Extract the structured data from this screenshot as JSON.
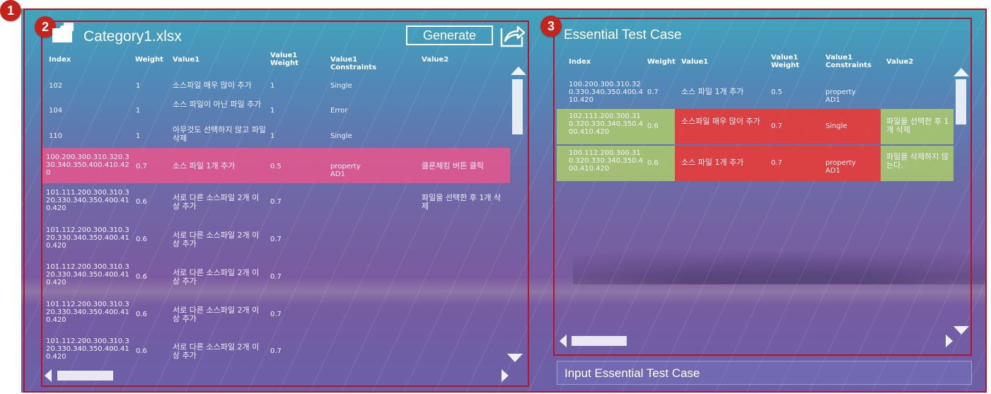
{
  "badges": [
    "1",
    "2",
    "3"
  ],
  "left_panel": {
    "file_name": "Category1.xlsx",
    "generate_label": "Generate",
    "columns": [
      "Index",
      "Weight",
      "Value1",
      "Value1 Weight",
      "Value1 Constraints",
      "Value2"
    ],
    "rows": [
      {
        "index": "102",
        "weight": "1",
        "value1": "소스파일 매우 많이 추가",
        "value1_weight": "1",
        "constraints": "Single",
        "value2": "",
        "highlight": false
      },
      {
        "index": "104",
        "weight": "1",
        "value1": "소스 파일이 아닌 파일 추가",
        "value1_weight": "1",
        "constraints": "Error",
        "value2": "",
        "highlight": false
      },
      {
        "index": "110",
        "weight": "1",
        "value1": "아무것도 선택하지 않고 파일 삭제",
        "value1_weight": "1",
        "constraints": "Single",
        "value2": "",
        "highlight": false
      },
      {
        "index": "100.200.300.310.320.330.340.350.400.410.420",
        "weight": "0.7",
        "value1": "소스 파일 1개 추가",
        "value1_weight": "0.5",
        "constraints": "property AD1",
        "value2": "클론체킹 버튼 클릭",
        "highlight": true
      },
      {
        "index": "101.111.200.300.310.320.330.340.350.400.410.420",
        "weight": "0.6",
        "value1": "서로 다른 소스파일 2개 이상 추가",
        "value1_weight": "0.7",
        "constraints": "",
        "value2": "파일을 선택한 후 1개 삭제",
        "highlight": false
      },
      {
        "index": "101.112.200.300.310.320.330.340.350.400.410.420",
        "weight": "0.6",
        "value1": "서로 다른 소스파일 2개 이상 추가",
        "value1_weight": "0.7",
        "constraints": "",
        "value2": "",
        "highlight": false
      },
      {
        "index": "101.112.200.300.310.320.330.340.350.400.410.420",
        "weight": "0.6",
        "value1": "서로 다른 소스파일 2개 이상 추가",
        "value1_weight": "0.7",
        "constraints": "",
        "value2": "",
        "highlight": false
      },
      {
        "index": "101.112.200.300.310.320.330.340.350.400.410.420",
        "weight": "0.6",
        "value1": "서로 다른 소스파일 2개 이상 추가",
        "value1_weight": "0.7",
        "constraints": "",
        "value2": "",
        "highlight": false
      },
      {
        "index": "101.112.200.300.310.320.330.340.350.400.410.420",
        "weight": "0.6",
        "value1": "서로 다른 소스파일 2개 이상 추가",
        "value1_weight": "0.7",
        "constraints": "",
        "value2": "",
        "highlight": false
      }
    ]
  },
  "right_panel": {
    "title": "Essential Test Case",
    "columns": [
      "Index",
      "Weight",
      "Value1",
      "Value1 Weight",
      "Value1 Constraints",
      "Value2"
    ],
    "rows": [
      {
        "index": "100.200.300.310.320.330.340.350.400.410.420",
        "weight": "0.7",
        "value1": "소스 파일 1개 추가",
        "value1_weight": "0.5",
        "constraints": "property AD1",
        "value2": "",
        "style": "plain"
      },
      {
        "index": "102.111.200.300.310.320.330.340.350.400.410.420",
        "weight": "0.6",
        "value1": "소스파일 매우 많이 추가",
        "value1_weight": "0.7",
        "constraints": "Single",
        "value2": "파일을 선택한 후 1개 삭제",
        "style": "marked"
      },
      {
        "index": "100.112.200.300.310.320.330.340.350.400.410.420",
        "weight": "0.6",
        "value1": "소스 파일 1개 추가",
        "value1_weight": "0.7",
        "constraints": "property AD1",
        "value2": "파일을 삭제하지 않는다.",
        "style": "marked"
      }
    ],
    "input_label": "Input Essential Test Case"
  },
  "colors": {
    "frame": "#b31426",
    "badge": "#c4231c",
    "row_highlight": "#e8568c",
    "cell_green": "#aac86e",
    "cell_red": "#e23e3c"
  },
  "icons": [
    "folder-icon",
    "export-icon",
    "scroll-up-icon",
    "scroll-down-icon",
    "scroll-left-icon",
    "scroll-right-icon"
  ]
}
